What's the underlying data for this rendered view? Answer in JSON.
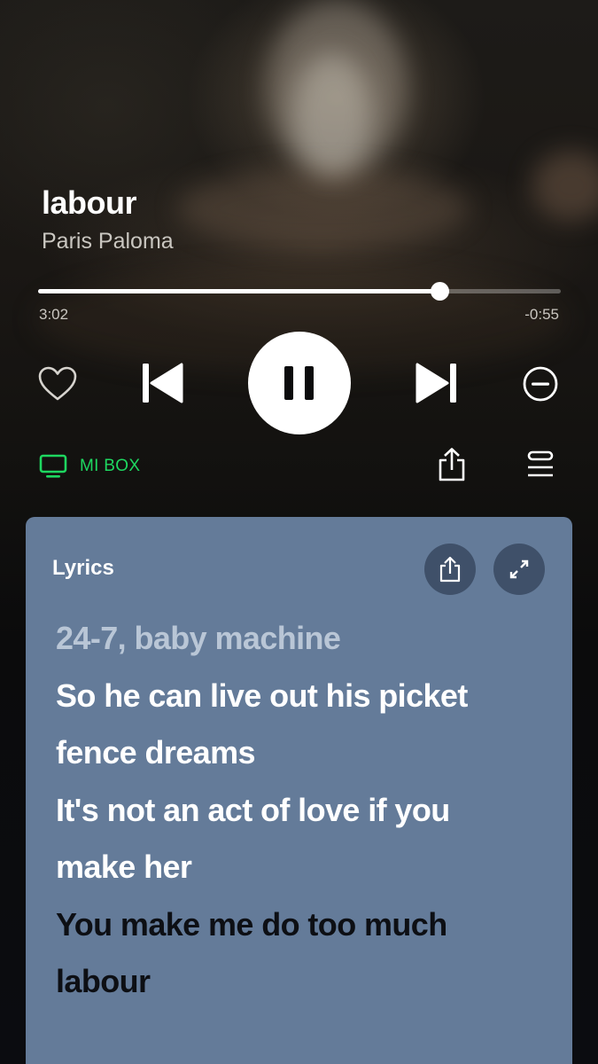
{
  "track": {
    "title": "labour",
    "artist": "Paris Paloma"
  },
  "playback": {
    "elapsed": "3:02",
    "remaining": "-0:55",
    "progress_fraction": 0.768,
    "state": "playing"
  },
  "device": {
    "label": "MI BOX",
    "color": "#1ed760",
    "icon": "tv-icon"
  },
  "controls": {
    "icons": [
      "heart-icon",
      "skip-previous-icon",
      "pause-icon",
      "skip-next-icon",
      "remove-circle-icon",
      "share-icon",
      "queue-icon"
    ]
  },
  "lyrics": {
    "heading": "Lyrics",
    "card_color": "#647b99",
    "lines": [
      {
        "text": "24-7, baby machine",
        "state": "past"
      },
      {
        "text": "So he can live out his picket",
        "state": "current"
      },
      {
        "text": "fence dreams",
        "state": "current"
      },
      {
        "text": "It's not an act of love if you",
        "state": "current"
      },
      {
        "text": "make her",
        "state": "current"
      },
      {
        "text": "You make me do too much",
        "state": "future"
      },
      {
        "text": "labour",
        "state": "future"
      }
    ]
  }
}
